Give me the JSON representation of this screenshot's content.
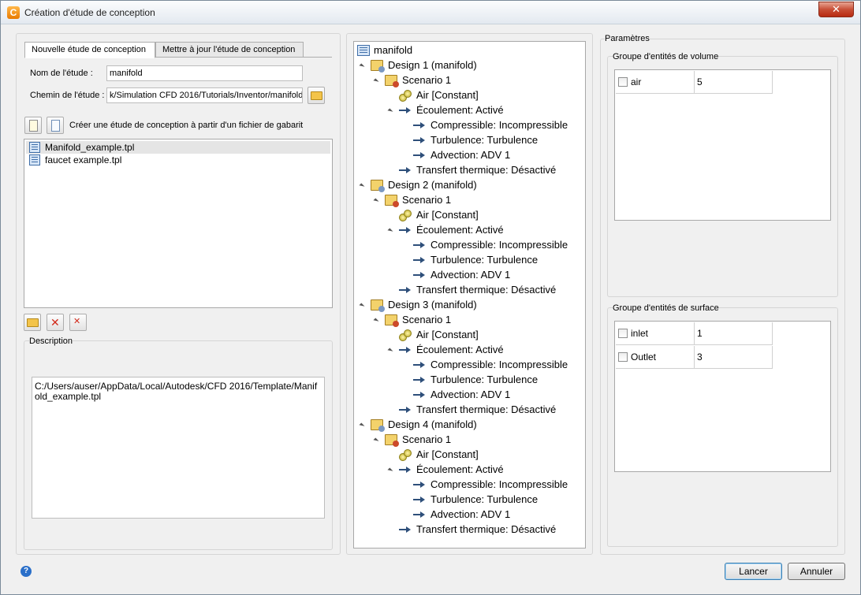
{
  "window": {
    "title": "Création d'étude de conception",
    "close": "✕"
  },
  "left": {
    "tabs": [
      "Nouvelle étude de conception",
      "Mettre à jour l'étude de conception"
    ],
    "study_name_label": "Nom de l'étude :",
    "study_name_value": "manifold",
    "study_path_label": "Chemin de l'étude :",
    "study_path_value": "k/Simulation CFD 2016/Tutorials/Inventor/manifold",
    "template_caption": "Créer une étude de conception à partir d'un fichier de gabarit",
    "templates": [
      "Manifold_example.tpl",
      "faucet example.tpl"
    ],
    "description_label": "Description",
    "description_text": "C:/Users/auser/AppData/Local/Autodesk/CFD 2016/Template/Manifold_example.tpl"
  },
  "tree": {
    "root": "manifold",
    "designs": [
      {
        "label": "Design 1 (manifold)",
        "scenario": "Scenario 1",
        "air": "Air [Constant]",
        "flow": "Écoulement: Activé",
        "flow_children": [
          "Compressible: Incompressible",
          "Turbulence: Turbulence",
          "Advection: ADV 1"
        ],
        "thermal": "Transfert thermique: Désactivé"
      },
      {
        "label": "Design 2 (manifold)",
        "scenario": "Scenario 1",
        "air": "Air [Constant]",
        "flow": "Écoulement: Activé",
        "flow_children": [
          "Compressible: Incompressible",
          "Turbulence: Turbulence",
          "Advection: ADV 1"
        ],
        "thermal": "Transfert thermique: Désactivé"
      },
      {
        "label": "Design 3 (manifold)",
        "scenario": "Scenario 1",
        "air": "Air [Constant]",
        "flow": "Écoulement: Activé",
        "flow_children": [
          "Compressible: Incompressible",
          "Turbulence: Turbulence",
          "Advection: ADV 1"
        ],
        "thermal": "Transfert thermique: Désactivé"
      },
      {
        "label": "Design 4 (manifold)",
        "scenario": "Scenario 1",
        "air": "Air [Constant]",
        "flow": "Écoulement: Activé",
        "flow_children": [
          "Compressible: Incompressible",
          "Turbulence: Turbulence",
          "Advection: ADV 1"
        ],
        "thermal": "Transfert thermique: Désactivé"
      }
    ]
  },
  "params": {
    "title": "Paramètres",
    "volume_group_title": "Groupe d'entités de volume",
    "volume_rows": [
      {
        "name": "air",
        "value": "5"
      }
    ],
    "surface_group_title": "Groupe d'entités de surface",
    "surface_rows": [
      {
        "name": "inlet",
        "value": "1"
      },
      {
        "name": "Outlet",
        "value": "3"
      }
    ]
  },
  "footer": {
    "help": "?",
    "launch": "Lancer",
    "cancel": "Annuler"
  },
  "colors": {
    "accent": "#3c7fb1",
    "close_button": "#c84f36",
    "tree_arrow": "#2e4f7a"
  }
}
